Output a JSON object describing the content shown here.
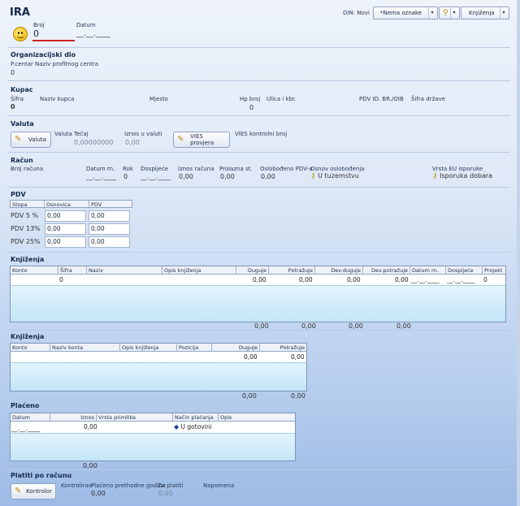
{
  "header": {
    "title": "IRA",
    "broj_label": "Broj",
    "broj_value": "0",
    "datum_label": "Datum",
    "datum_value": "__.__.____",
    "din_label": "DIN: Novi",
    "oznaka_combo": "*Nema oznake",
    "knjizenja_combo": "Knjiženja"
  },
  "org": {
    "heading": "Organizacijski dio",
    "pcentar_label": "P.centar",
    "pcentar_value": "0",
    "naziv_label": "Naziv profitnog centra"
  },
  "kupac": {
    "heading": "Kupac",
    "sifra_label": "Šifra",
    "sifra_value": "0",
    "naziv_label": "Naziv kupca",
    "mjesto_label": "Mjesto",
    "hp_label": "Hp broj",
    "hp_value": "0",
    "ulica_label": "Ulica i kbr.",
    "pdv_label": "PDV ID. BR./OIB",
    "drzava_label": "Šifra države"
  },
  "valuta": {
    "heading": "Valuta",
    "button": "Valuta",
    "valuta_label": "Valuta",
    "tecaj_label": "Tečaj",
    "tecaj_value": "0,00000000",
    "iznos_label": "Iznos u valuti",
    "iznos_value": "0,00",
    "vies_button": "VIES provjera",
    "vies_label": "VIES kontrolni broj"
  },
  "racun": {
    "heading": "Račun",
    "broj_label": "Broj računa",
    "datum_label": "Datum rn.",
    "datum_value": "__.__.____",
    "rok_label": "Rok",
    "rok_value": "0",
    "dospijece_label": "Dospijeće",
    "dospijece_value": "__.__.____",
    "iznos_label": "Iznos računa",
    "iznos_value": "0,00",
    "prolazna_label": "Prolazna st.",
    "prolazna_value": "0,00",
    "oslobodeno_label": "Oslobođeno PDV-a",
    "oslobodeno_value": "0,00",
    "osnov_label": "Osnov oslobođenja",
    "osnov_value": "U tuzemstvu",
    "eu_label": "Vrsta EU isporuke",
    "eu_value": "Isporuka dobara"
  },
  "pdv": {
    "heading": "PDV",
    "col_stopa": "Stopa",
    "col_osnovica": "Osnovica",
    "col_pdv": "PDV",
    "rows": [
      {
        "stopa": "PDV 5 %",
        "osnovica": "0,00",
        "pdv": "0,00"
      },
      {
        "stopa": "PDV 13%",
        "osnovica": "0,00",
        "pdv": "0,00"
      },
      {
        "stopa": "PDV 25%",
        "osnovica": "0,00",
        "pdv": "0,00"
      }
    ]
  },
  "knjizenja1": {
    "heading": "Knjiženja",
    "cols": [
      "Konto",
      "Šifra",
      "Naziv",
      "Opis knjiženja",
      "Duguje",
      "Potražuje",
      "Dev.duguje",
      "Dev.potražuje",
      "Datum rn.",
      "Dospijeće",
      "Projekt"
    ],
    "row": [
      "",
      "0",
      "",
      "",
      "0,00",
      "0,00",
      "0,00",
      "0,00",
      "__.__.____",
      "__.__.____",
      "0"
    ],
    "totals": [
      "0,00",
      "0,00",
      "0,00",
      "0,00"
    ]
  },
  "knjizenja2": {
    "heading": "Knjiženja",
    "cols": [
      "Konto",
      "Naziv konta",
      "Opis knjiženja",
      "Pozicija",
      "Duguje",
      "Potražuje"
    ],
    "row": [
      "",
      "",
      "",
      "",
      "0,00",
      "0,00"
    ],
    "totals": [
      "0,00",
      "0,00"
    ]
  },
  "placeno": {
    "heading": "Plaćeno",
    "cols": [
      "Datum plaćanja",
      "Iznos",
      "Vrsta primitka",
      "Način plaćanja",
      "Opis"
    ],
    "row": [
      "__.__.____",
      "0,00",
      "",
      "U gotovini",
      ""
    ],
    "total": "0,00"
  },
  "platiti": {
    "heading": "Platiti po računu",
    "button": "Kontrolor",
    "kontrolirao_label": "Kontrolirao",
    "placeno_label": "Plaćeno prethodne godine",
    "placeno_value": "0,00",
    "za_platiti_label": "Za platiti",
    "za_platiti_value": "0,00",
    "napomena_label": "Napomena"
  }
}
